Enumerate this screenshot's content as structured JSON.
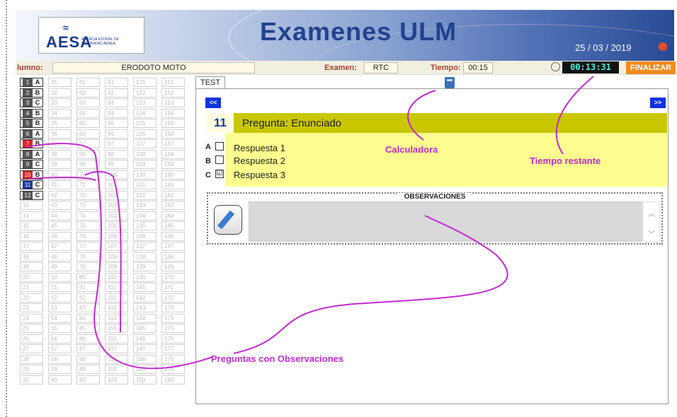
{
  "header": {
    "logo_text": "AESA",
    "logo_sub": "AGENCIA ESTATAL DE SEGURIDAD AÉREA",
    "title": "Examenes ULM",
    "date": "25 / 03 / 2019"
  },
  "status": {
    "alumno_label": "lumno:",
    "alumno_value": "ERODOTO MOTO",
    "examen_label": "Examen:",
    "examen_value": "RTC",
    "tiempo_label": "Tiempo:",
    "tiempo_value": "00:15",
    "timer": "00:13:31",
    "finalizar": "FINALIZAR"
  },
  "grid": {
    "answered": [
      {
        "num": "1",
        "ans": "A"
      },
      {
        "num": "2",
        "ans": "B"
      },
      {
        "num": "3",
        "ans": "C"
      },
      {
        "num": "4",
        "ans": "B"
      },
      {
        "num": "5",
        "ans": "B"
      },
      {
        "num": "6",
        "ans": "A"
      },
      {
        "num": "7",
        "ans": "B"
      },
      {
        "num": "8",
        "ans": "A"
      },
      {
        "num": "9",
        "ans": "C"
      },
      {
        "num": "10",
        "ans": "B"
      },
      {
        "num": "11",
        "ans": "C"
      },
      {
        "num": "12",
        "ans": "C"
      }
    ]
  },
  "main": {
    "tab": "TEST",
    "prev": "<<",
    "next": ">>",
    "question_num": "11",
    "question_text": "Pregunta: Enunciado",
    "answers": [
      {
        "letter": "A",
        "label": "Respuesta 1",
        "mark": ""
      },
      {
        "letter": "B",
        "label": "Respuesta 2",
        "mark": ""
      },
      {
        "letter": "C",
        "label": "Respuesta 3",
        "mark": "☑"
      }
    ],
    "obs_title": "OBSERVACIONES"
  },
  "annotations": {
    "calc": "Calculadora",
    "tiempo": "Tiempo restante",
    "obs": "Preguntas con Observaciones"
  },
  "colors": {
    "accent": "#c02bd0",
    "question_bar": "#c9c700",
    "answers_bg": "#fdfc8f",
    "finalizar": "#f28c1e"
  }
}
